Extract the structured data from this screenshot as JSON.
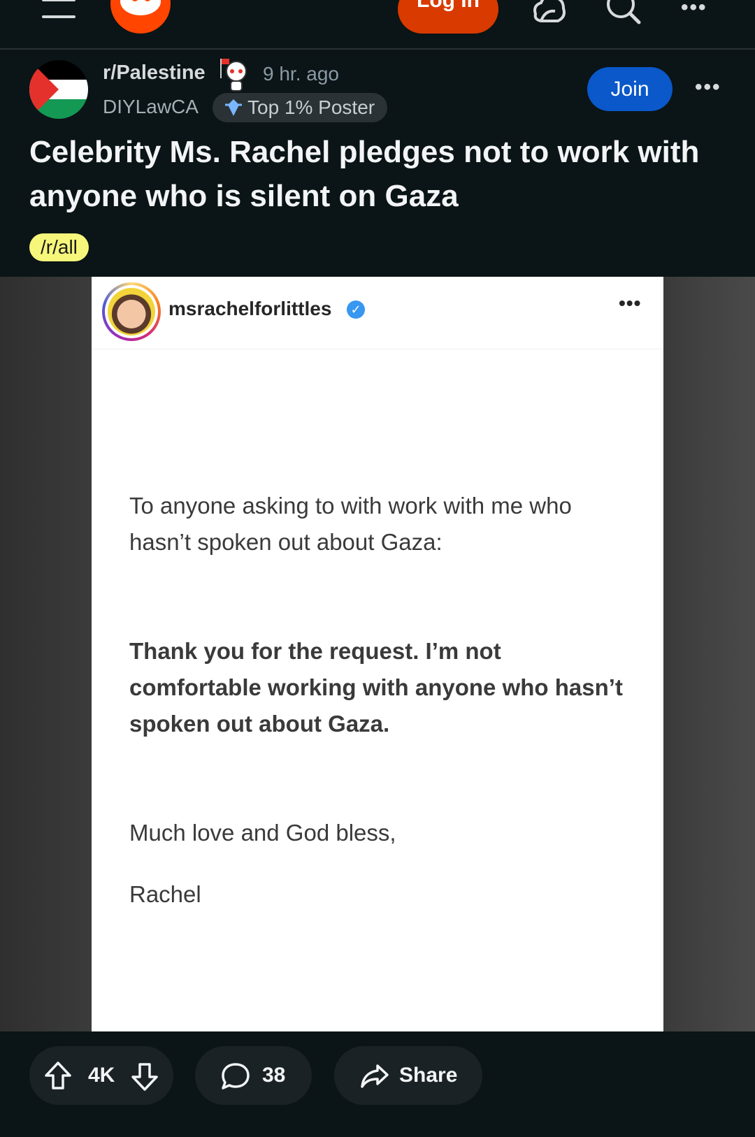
{
  "topbar": {
    "login_label": "Log In"
  },
  "post": {
    "subreddit": "r/Palestine",
    "time": "9 hr. ago",
    "username": "DIYLawCA",
    "user_flair": "Top 1% Poster",
    "join_label": "Join",
    "title": "Celebrity Ms. Rachel pledges not to work with anyone who is silent on Gaza",
    "tag": "/r/all"
  },
  "embedded_post": {
    "account": "msrachelforlittles",
    "paragraph1": "To anyone asking to with work with me who hasn’t spoken out about Gaza:",
    "paragraph2": "Thank you for the request. I’m not comfortable working with anyone who hasn’t spoken out about Gaza.",
    "paragraph3": "Much love and God bless,",
    "signature": "Rachel"
  },
  "actions": {
    "score": "4K",
    "comments": "38",
    "share_label": "Share"
  },
  "colors": {
    "background": "#0b1416",
    "login_orange": "#d93a00",
    "join_blue": "#0a58ca",
    "tag_yellow": "#f6f77a"
  }
}
